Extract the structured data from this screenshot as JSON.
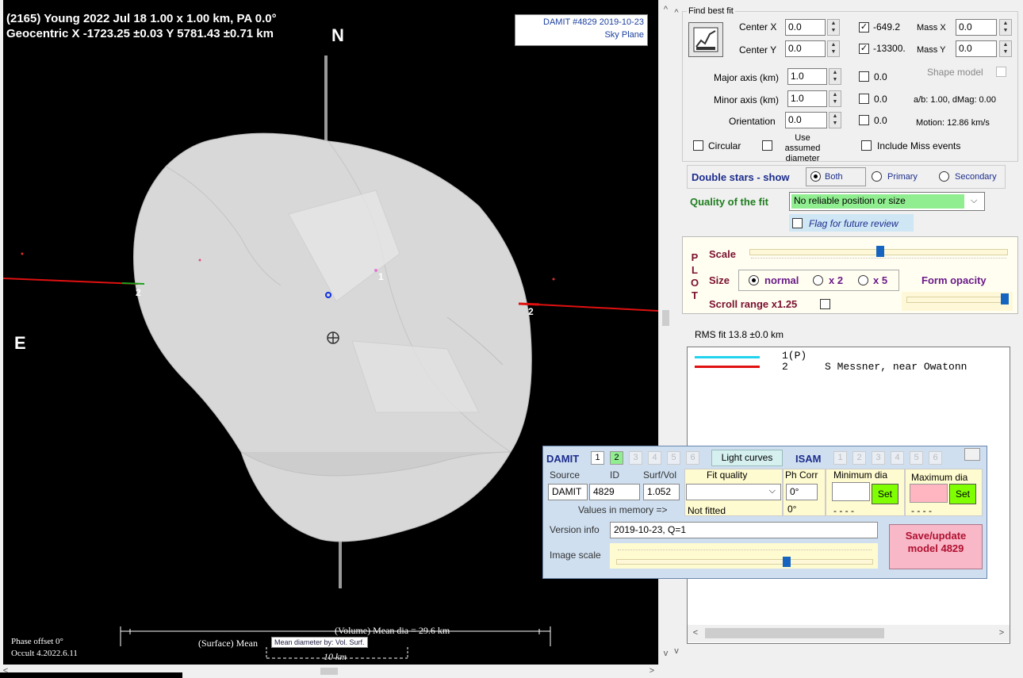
{
  "plot": {
    "title": "(2165) Young  2022 Jul 18  1.00 x 1.00 km, PA 0.0°",
    "geocentric": "Geocentric X -1723.25 ±0.03 Y 5781.43 ±0.71 km",
    "north": "N",
    "east": "E",
    "damit_label": "DAMIT #4829 2019-10-23",
    "sky_plane": "Sky Plane",
    "chord_label_1": "1",
    "chord_label_2a": "2",
    "chord_label_2b": "2",
    "volume_dia": "(Volume) Mean dia = 29.6 km",
    "surface_dia": "(Surface) Mean",
    "mean_dia_by": "Mean diameter by:  Vol.  Surf.",
    "scale_km": "10 km",
    "phase_offset": "Phase offset 0°",
    "occult_version": "Occult 4.2022.6.11"
  },
  "fit": {
    "title": "Find best fit",
    "center_x_label": "Center X",
    "center_x": "0.0",
    "center_y_label": "Center Y",
    "center_y": "0.0",
    "cx_val": "-649.2",
    "cy_val": "-13300.",
    "mass_x_label": "Mass X",
    "mass_x": "0.0",
    "mass_y_label": "Mass Y",
    "mass_y": "0.0",
    "major_label": "Major axis (km)",
    "major": "1.0",
    "major_chk": "0.0",
    "shape_model": "Shape model",
    "minor_label": "Minor axis (km)",
    "minor": "1.0",
    "minor_chk": "0.0",
    "ab_info": "a/b: 1.00, dMag: 0.00",
    "orient_label": "Orientation",
    "orient": "0.0",
    "orient_chk": "0.0",
    "motion": "Motion: 12.86 km/s",
    "circular": "Circular",
    "use_assumed": "Use assumed",
    "diameter": "diameter",
    "include_miss": "Include Miss events"
  },
  "double_stars": {
    "label": "Double stars - show",
    "both": "Both",
    "primary": "Primary",
    "secondary": "Secondary"
  },
  "quality": {
    "label": "Quality of the fit",
    "value": "No reliable position or size",
    "flag": "Flag for future review"
  },
  "plotpanel": {
    "p": "P",
    "l": "L",
    "o": "O",
    "t": "T",
    "scale": "Scale",
    "size": "Size",
    "normal": "normal",
    "x2": "x 2",
    "x5": "x 5",
    "form_opacity": "Form opacity",
    "scroll_range": "Scroll range x1.25"
  },
  "rms": "RMS fit 13.8 ±0.0 km",
  "chords": [
    {
      "num": "1(P)",
      "name": "",
      "color": "#22d3ee"
    },
    {
      "num": "2",
      "name": "S Messner, near Owatonn",
      "color": "#e01010"
    }
  ],
  "damit": {
    "title": "DAMIT",
    "tabs": [
      "1",
      "2",
      "3",
      "4",
      "5",
      "6"
    ],
    "light_curves": "Light curves",
    "isam": "ISAM",
    "isam_tabs": [
      "1",
      "2",
      "3",
      "4",
      "5",
      "6"
    ],
    "source_h": "Source",
    "id_h": "ID",
    "surf_h": "Surf/Vol",
    "fitq_h": "Fit quality",
    "phcorr_h": "Ph Corr",
    "mindia_h": "Minimum dia",
    "maxdia_h": "Maximum dia",
    "source": "DAMIT",
    "id": "4829",
    "surf": "1.052",
    "phcorr": "0°",
    "set1": "Set",
    "set2": "Set",
    "values_mem": "Values in memory =>",
    "not_fitted": "Not fitted",
    "phcorr_mem": "0°",
    "min_mem": "- - - -",
    "max_mem": "- - - -",
    "version_label": "Version info",
    "version": "2019-10-23, Q=1",
    "image_scale": "Image scale",
    "save_1": "Save/update",
    "save_2": "model 4829"
  }
}
